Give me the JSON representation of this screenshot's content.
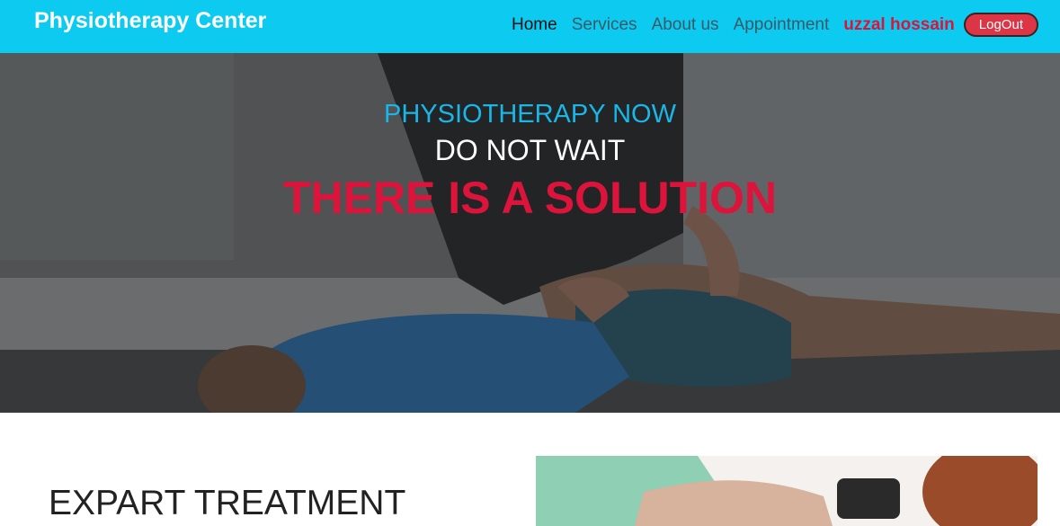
{
  "navbar": {
    "brand": "Physiotherapy Center",
    "links": [
      {
        "label": "Home",
        "active": true
      },
      {
        "label": "Services",
        "active": false
      },
      {
        "label": "About us",
        "active": false
      },
      {
        "label": "Appointment",
        "active": false
      }
    ],
    "user_name": "uzzal hossain",
    "logout_label": "LogOut",
    "colors": {
      "bar": "#0dcaf0",
      "user": "#dc143c",
      "logout": "#dc3545"
    }
  },
  "hero": {
    "line1": "PHYSIOTHERAPY NOW",
    "line2": "DO NOT WAIT",
    "line3": "THERE IS A SOLUTION",
    "colors": {
      "line1": "#1ab6e8",
      "line2": "#ffffff",
      "line3": "#dc143c"
    }
  },
  "section": {
    "title": "EXPART TREATMENT"
  }
}
